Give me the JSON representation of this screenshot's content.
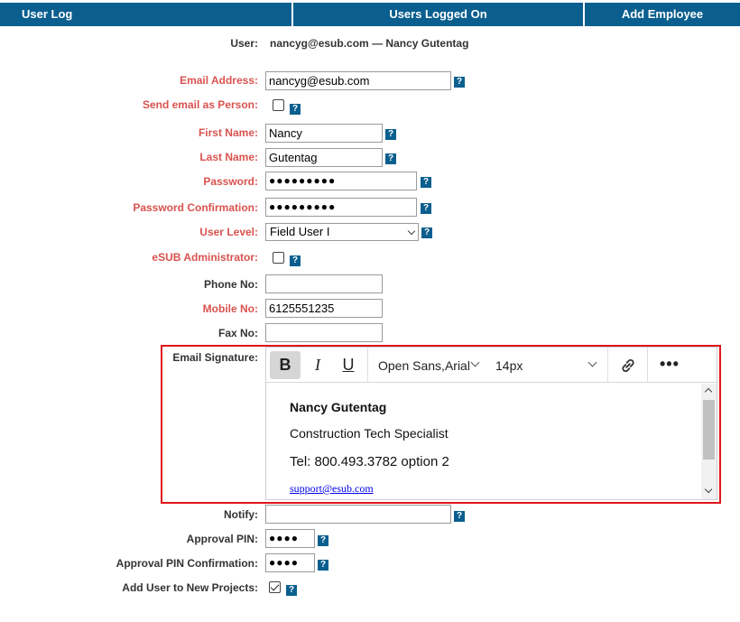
{
  "tabs": [
    {
      "label": "User Log"
    },
    {
      "label": "Users Logged On"
    },
    {
      "label": "Add Employee"
    }
  ],
  "user": {
    "label": "User:",
    "value": "nancyg@esub.com — Nancy Gutentag"
  },
  "fields": {
    "email": {
      "label": "Email Address:",
      "value": "nancyg@esub.com"
    },
    "send_as_person": {
      "label": "Send email as Person:",
      "checked": false
    },
    "first_name": {
      "label": "First Name:",
      "value": "Nancy"
    },
    "last_name": {
      "label": "Last Name:",
      "value": "Gutentag"
    },
    "password": {
      "label": "Password:",
      "value": "●●●●●●●●●"
    },
    "password_confirm": {
      "label": "Password Confirmation:",
      "value": "●●●●●●●●●"
    },
    "user_level": {
      "label": "User Level:",
      "value": "Field User I"
    },
    "esub_admin": {
      "label": "eSUB Administrator:",
      "checked": false
    },
    "phone": {
      "label": "Phone No:",
      "value": ""
    },
    "mobile": {
      "label": "Mobile No:",
      "value": "6125551235"
    },
    "fax": {
      "label": "Fax No:",
      "value": ""
    },
    "email_signature": {
      "label": "Email Signature:"
    },
    "notify": {
      "label": "Notify:",
      "value": ""
    },
    "approval_pin": {
      "label": "Approval PIN:",
      "value": "●●●●"
    },
    "approval_pin_confirm": {
      "label": "Approval PIN Confirmation:",
      "value": "●●●●"
    },
    "add_to_projects": {
      "label": "Add User to New Projects:",
      "checked": true
    }
  },
  "help_glyph": "?",
  "editor": {
    "toolbar": {
      "bold": "B",
      "italic": "I",
      "underline": "U",
      "font_family": "Open Sans,Arial",
      "font_size": "14px",
      "more": "•••"
    },
    "signature": {
      "name": "Nancy Gutentag",
      "title": "Construction Tech Specialist",
      "tel": "Tel: 800.493.3782 option 2",
      "link": "support@esub.com"
    }
  },
  "colors": {
    "tab_bg": "#0a5f8f",
    "required_label": "#d9534f",
    "highlight_border": "#e0141b"
  }
}
